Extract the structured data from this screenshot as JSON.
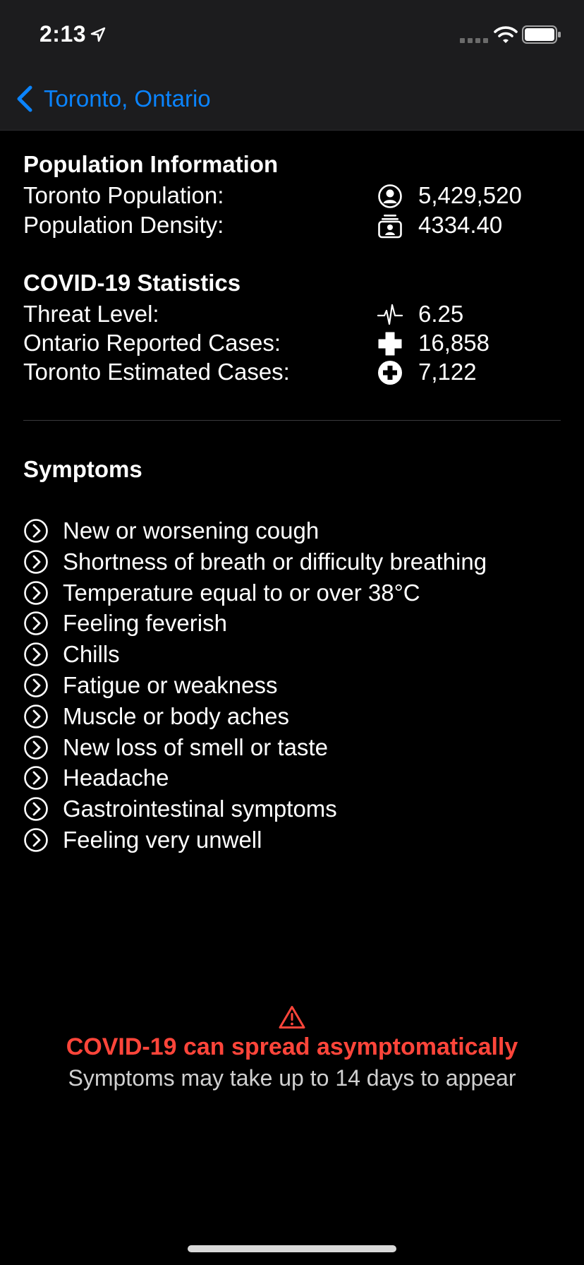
{
  "status_bar": {
    "time": "2:13"
  },
  "nav": {
    "back_label": "Toronto, Ontario"
  },
  "population": {
    "title": "Population Information",
    "rows": [
      {
        "label": "Toronto Population:",
        "value": "5,429,520",
        "icon": "person-circle-icon"
      },
      {
        "label": "Population Density:",
        "value": "4334.40",
        "icon": "person-group-icon"
      }
    ]
  },
  "covid": {
    "title": "COVID-19 Statistics",
    "rows": [
      {
        "label": "Threat Level:",
        "value": "6.25",
        "icon": "waveform-icon"
      },
      {
        "label": "Ontario Reported Cases:",
        "value": "16,858",
        "icon": "cross-icon"
      },
      {
        "label": "Toronto Estimated Cases:",
        "value": "7,122",
        "icon": "cross-circle-icon"
      }
    ]
  },
  "symptoms": {
    "title": "Symptoms",
    "items": [
      "New or worsening cough",
      "Shortness of breath or difficulty breathing",
      "Temperature equal to or over 38°C",
      "Feeling feverish",
      "Chills",
      "Fatigue or weakness",
      "Muscle or body aches",
      "New loss of smell or taste",
      "Headache",
      "Gastrointestinal symptoms",
      "Feeling very unwell"
    ]
  },
  "warning": {
    "title": "COVID-19 can spread asymptomatically",
    "subtitle": "Symptoms may take up to 14 days to appear"
  },
  "colors": {
    "accent": "#0a84ff",
    "warning": "#ff453a",
    "background": "#000000",
    "bar": "#1c1c1e"
  }
}
